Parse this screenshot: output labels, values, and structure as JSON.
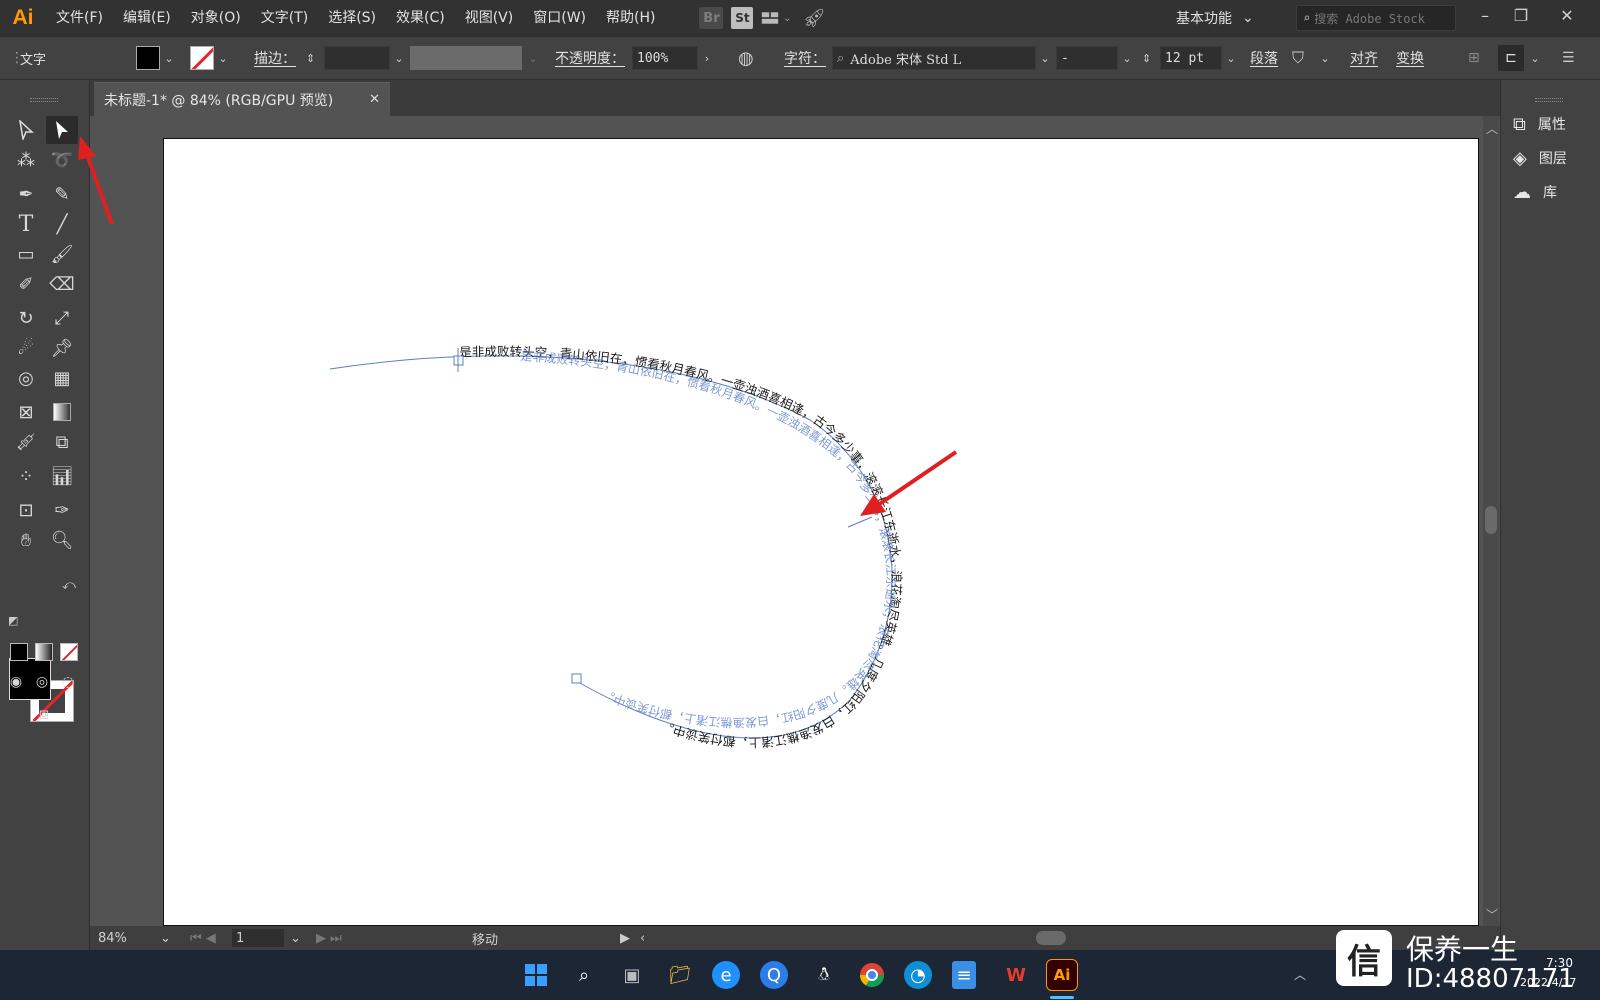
{
  "app": {
    "logo": "Ai",
    "menus": [
      "文件(F)",
      "编辑(E)",
      "对象(O)",
      "文字(T)",
      "选择(S)",
      "效果(C)",
      "视图(V)",
      "窗口(W)",
      "帮助(H)"
    ],
    "bridge_label": "Br",
    "stock_label": "St",
    "workspace": "基本功能",
    "search_placeholder": "搜索 Adobe Stock"
  },
  "control_bar": {
    "object_type": "文字",
    "stroke_label": "描边：",
    "opacity_label": "不透明度：",
    "opacity_value": "100%",
    "character_label": "字符：",
    "font_name": "Adobe 宋体 Std L",
    "font_style": "-",
    "font_size": "12 pt",
    "paragraph_label": "段落",
    "align_label": "对齐",
    "transform_label": "变换"
  },
  "document": {
    "tab_title": "未标题-1* @ 84% (RGB/GPU 预览)",
    "path_text": "是非成败转头空，青山依旧在，惯看秋月春风。一壶浊酒喜相逢，古今多少事，滚滚长江东逝水，浪花淘尽英雄。几度夕阳红，白发渔樵江渚上，都付笑谈中。",
    "stroke_color": "#5b7fc4"
  },
  "status_bar": {
    "zoom": "84%",
    "artboard_number": "1",
    "status_text": "移动"
  },
  "right_panel": {
    "items": [
      {
        "label": "属性",
        "icon": "properties-icon"
      },
      {
        "label": "图层",
        "icon": "layers-icon"
      },
      {
        "label": "库",
        "icon": "libraries-icon"
      }
    ]
  },
  "taskbar": {
    "icons": [
      "windows-start-icon",
      "search-icon",
      "task-view-icon",
      "file-explorer-icon",
      "ie-icon",
      "quickfind-icon",
      "qq-icon",
      "chrome-icon",
      "edge-icon",
      "notepad-icon",
      "wps-icon",
      "illustrator-icon"
    ],
    "time": "7:30",
    "date": "2022/4/17"
  },
  "watermark": {
    "brand": "保养一生",
    "id_text": "ID:48807171"
  }
}
